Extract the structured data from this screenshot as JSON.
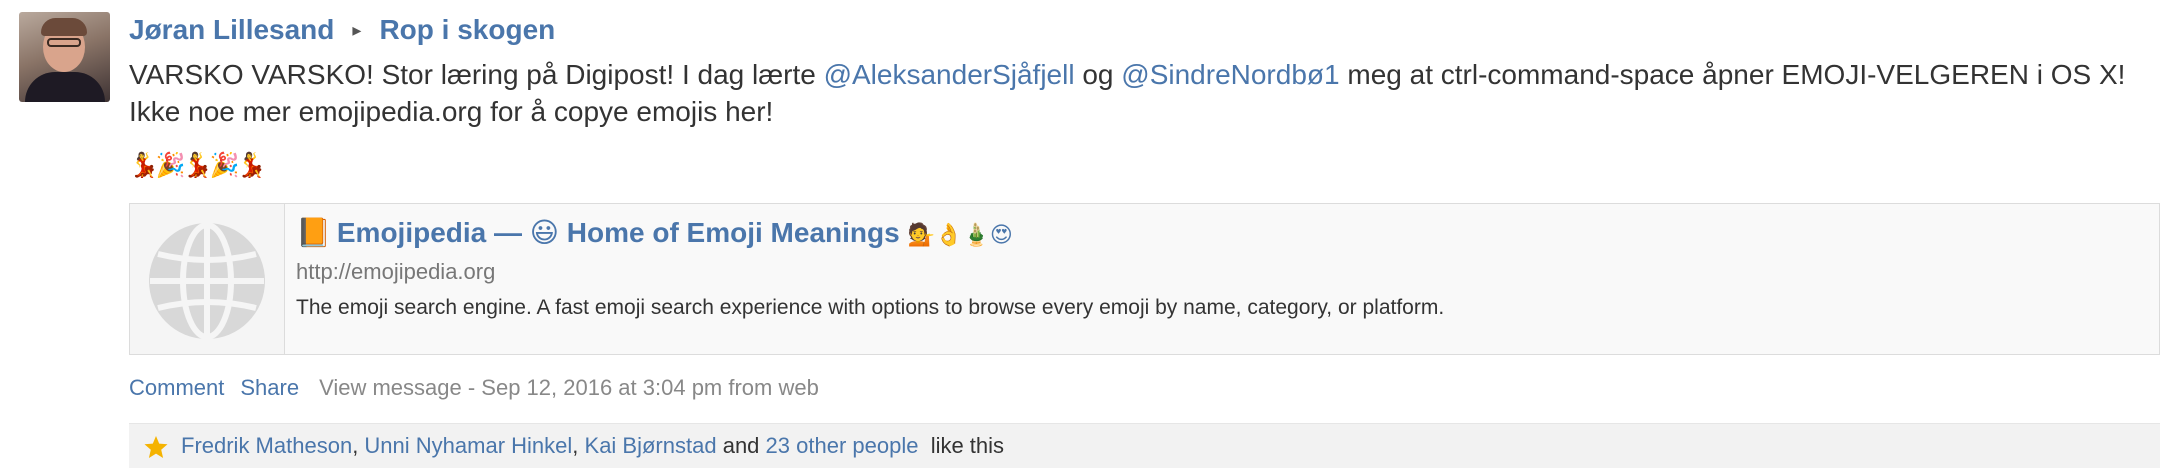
{
  "post": {
    "author": "Jøran Lillesand",
    "group": "Rop i skogen",
    "message_parts": {
      "p1": "VARSKO VARSKO! Stor læring på Digipost! I dag lærte ",
      "mention1": "@AleksanderSjåfjell",
      "p2": " og ",
      "mention2": "@SindreNordbø1",
      "p3": " meg at ctrl-command-space åpner EMOJI-VELGEREN i OS X! Ikke noe mer emojipedia.org for å copye emojis her!"
    },
    "emoji_line": "💃🎉💃🎉💃"
  },
  "link_preview": {
    "icon": "📙",
    "title": "Emojipedia — 😃 Home of Emoji Meanings",
    "title_emojis": "💁👌🎍😍",
    "url": "http://emojipedia.org",
    "description": "The emoji search engine. A fast emoji search experience with options to browse every emoji by name, category, or platform.",
    "thumbnail": "globe-icon"
  },
  "actions": {
    "comment": "Comment",
    "share": "Share",
    "view_message": "View message",
    "meta": " - Sep 12, 2016 at 3:04 pm from web"
  },
  "likes": {
    "names": [
      "Fredrik Matheson",
      "Unni Nyhamar Hinkel",
      "Kai Bjørnstad"
    ],
    "and": "and",
    "others": "23 other people",
    "suffix": "like this"
  },
  "colors": {
    "link": "#4a76ab",
    "star": "#f5b301",
    "text": "#333333",
    "muted": "#888888"
  }
}
